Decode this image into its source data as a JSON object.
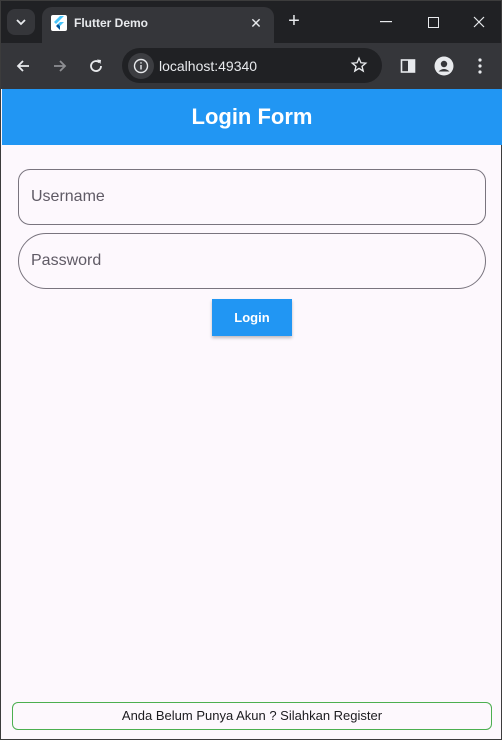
{
  "browser": {
    "tab_title": "Flutter Demo",
    "url": "localhost:49340"
  },
  "app": {
    "title": "Login Form",
    "username_placeholder": "Username",
    "password_placeholder": "Password",
    "login_label": "Login",
    "register_text": "Anda Belum Punya Akun ? Silahkan Register"
  },
  "colors": {
    "app_bar": "#2196f3",
    "button": "#2196f3",
    "register_border": "#4caf50",
    "page_background": "#fdf8fd",
    "browser_chrome": "#35363a"
  },
  "icons": [
    "tab-search-icon",
    "flutter-icon",
    "close-icon",
    "plus-icon",
    "minimize-icon",
    "maximize-icon",
    "close-window-icon",
    "back-arrow-icon",
    "forward-arrow-icon",
    "reload-icon",
    "info-icon",
    "star-icon",
    "side-panel-icon",
    "profile-icon",
    "menu-icon"
  ]
}
